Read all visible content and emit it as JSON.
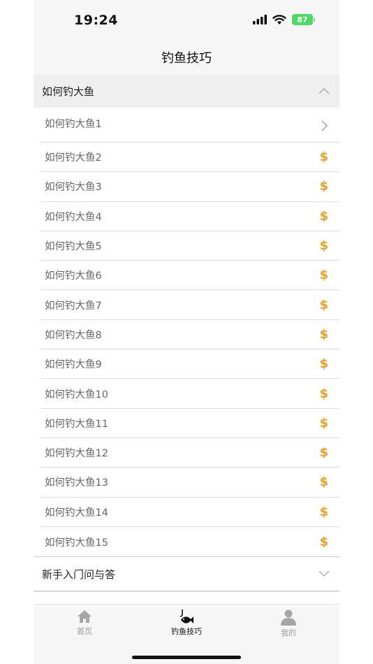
{
  "status_bar": {
    "time": "19:24",
    "battery": "87"
  },
  "nav": {
    "title": "钓鱼技巧"
  },
  "sections": [
    {
      "title": "如何钓大鱼",
      "expanded": true,
      "items": [
        {
          "label": "如何钓大鱼1",
          "icon": "chevron-right-icon"
        },
        {
          "label": "如何钓大鱼2",
          "icon": "coin-icon"
        },
        {
          "label": "如何钓大鱼3",
          "icon": "coin-icon"
        },
        {
          "label": "如何钓大鱼4",
          "icon": "coin-icon"
        },
        {
          "label": "如何钓大鱼5",
          "icon": "coin-icon"
        },
        {
          "label": "如何钓大鱼6",
          "icon": "coin-icon"
        },
        {
          "label": "如何钓大鱼7",
          "icon": "coin-icon"
        },
        {
          "label": "如何钓大鱼8",
          "icon": "coin-icon"
        },
        {
          "label": "如何钓大鱼9",
          "icon": "coin-icon"
        },
        {
          "label": "如何钓大鱼10",
          "icon": "coin-icon"
        },
        {
          "label": "如何钓大鱼11",
          "icon": "coin-icon"
        },
        {
          "label": "如何钓大鱼12",
          "icon": "coin-icon"
        },
        {
          "label": "如何钓大鱼13",
          "icon": "coin-icon"
        },
        {
          "label": "如何钓大鱼14",
          "icon": "coin-icon"
        },
        {
          "label": "如何钓大鱼15",
          "icon": "coin-icon"
        }
      ]
    },
    {
      "title": "新手入门问与答",
      "expanded": false
    }
  ],
  "coin_symbol": "$",
  "coin_color": "#f0a020",
  "tabs": [
    {
      "label": "首页",
      "icon": "home-icon",
      "active": false
    },
    {
      "label": "钓鱼技巧",
      "icon": "fishing-icon",
      "active": true
    },
    {
      "label": "我的",
      "icon": "person-icon",
      "active": false
    }
  ]
}
